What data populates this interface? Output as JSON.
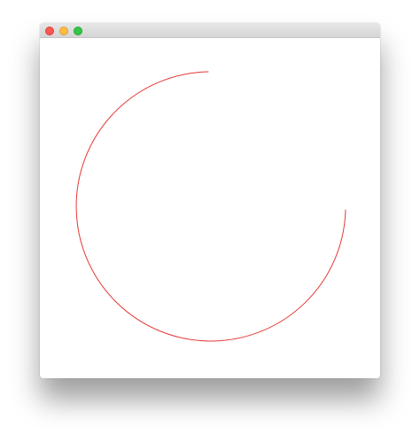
{
  "window": {
    "traffic_lights": {
      "close": "#fc5753",
      "minimize": "#fdbc40",
      "zoom": "#33c748"
    }
  },
  "canvas": {
    "arc_color": "#e53935"
  }
}
